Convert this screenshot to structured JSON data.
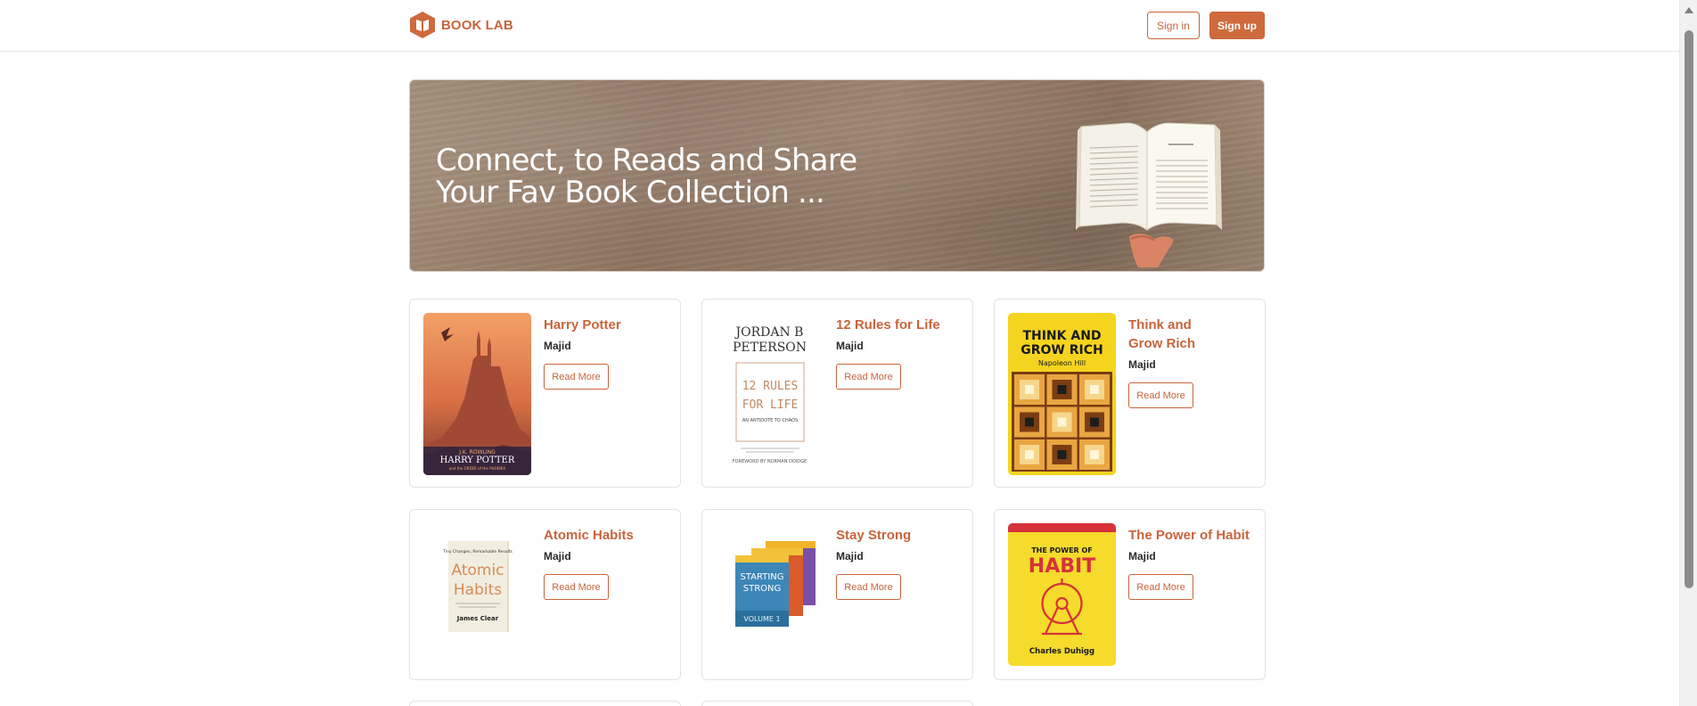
{
  "brand": {
    "name": "BOOK LAB",
    "accent": "#c8643b"
  },
  "nav": {
    "sign_in": "Sign in",
    "sign_up": "Sign up"
  },
  "hero": {
    "line1": "Connect, to Reads and Share",
    "line2": "Your Fav Book Collection ..."
  },
  "books": [
    {
      "title": "Harry Potter",
      "author": "Majid",
      "action": "Read More",
      "cover": {
        "line1": "J.K. ROWLING",
        "line2": "HARRY POTTER",
        "line3": "and the ORDER of the PHOENIX"
      }
    },
    {
      "title": "12 Rules for Life",
      "author": "Majid",
      "action": "Read More",
      "cover": {
        "line1": "JORDAN B",
        "line2": "PETERSON",
        "line3": "12 RULES",
        "line4": "FOR LIFE",
        "line5": "AN ANTIDOTE TO CHAOS",
        "line6": "FOREWORD BY NORMAN DOIDGE"
      }
    },
    {
      "title": "Think and Grow Rich",
      "author": "Majid",
      "action": "Read More",
      "cover": {
        "line1": "THINK AND",
        "line2": "GROW RICH",
        "line3": "Napoleon Hill"
      }
    },
    {
      "title": "Atomic Habits",
      "author": "Majid",
      "action": "Read More",
      "cover": {
        "line1": "Tiny Changes, Remarkable Results",
        "line2": "Atomic",
        "line3": "Habits",
        "line4": "James Clear"
      }
    },
    {
      "title": "Stay Strong",
      "author": "Majid",
      "action": "Read More",
      "cover": {
        "line1": "STARTING",
        "line2": "STRONG",
        "line3": "VOLUME 1"
      }
    },
    {
      "title": "The Power of Habit",
      "author": "Majid",
      "action": "Read More",
      "cover": {
        "line1": "THE POWER OF",
        "line2": "HABIT",
        "line3": "Charles Duhigg"
      }
    }
  ]
}
